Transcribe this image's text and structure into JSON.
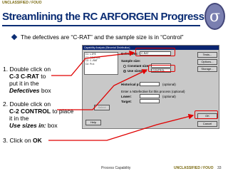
{
  "classification_top": "UNCLASSIFIED / FOUO",
  "title": "Streamlining the RC ARFORGEN Progression",
  "logo_glyph": "σ",
  "bullet": "The defectives are “C-RAT” and the sample size is in “Control”",
  "steps": {
    "s1_a": "1. Double click on",
    "s1_b": "C-3 C-RAT",
    "s1_c": " to",
    "s1_d": "put it in the",
    "s1_e": "Defectives",
    "s1_f": " box",
    "s2_a": "2. Double click on",
    "s2_b": "C-2 CONTROL",
    "s2_c": " to place",
    "s2_d": "it in the",
    "s2_e": "Use sizes in:",
    "s2_f": "  box",
    "s3_a": "3. Click on ",
    "s3_b": "OK"
  },
  "dialog": {
    "title": "Capability Analysis (Binomial Distribution)",
    "list_items": [
      "C1  LIFE",
      "C2  CONTROL",
      "C3  C-RAT",
      "C4  Pct"
    ],
    "defectives_label": "Defectives:",
    "defectives_value": "C-RAT",
    "sample_size_label": "Sample size:",
    "constant_size_label": "Constant size:",
    "use_sizes_label": "Use sizes in:",
    "use_sizes_value": "CONTROL",
    "historical_p_label": "Historical p:",
    "optional": "(optional)",
    "nd_text": "Enter a NDefective for this process (optional)",
    "lower_label": "Lower:",
    "target_label": "Target:",
    "select_button": "Select",
    "help_button": "Help",
    "tests_button": "Tests...",
    "options_button": "Options...",
    "storage_button": "Storage...",
    "ok_button": "OK",
    "cancel_button": "Cancel"
  },
  "footer": {
    "center": "Process Capability",
    "classification": "UNCLASSIFIED / FOUO",
    "page": "33"
  },
  "colors": {
    "title": "#0b2d74",
    "highlight": "#e00000",
    "footer_class": "#7a6a10"
  }
}
